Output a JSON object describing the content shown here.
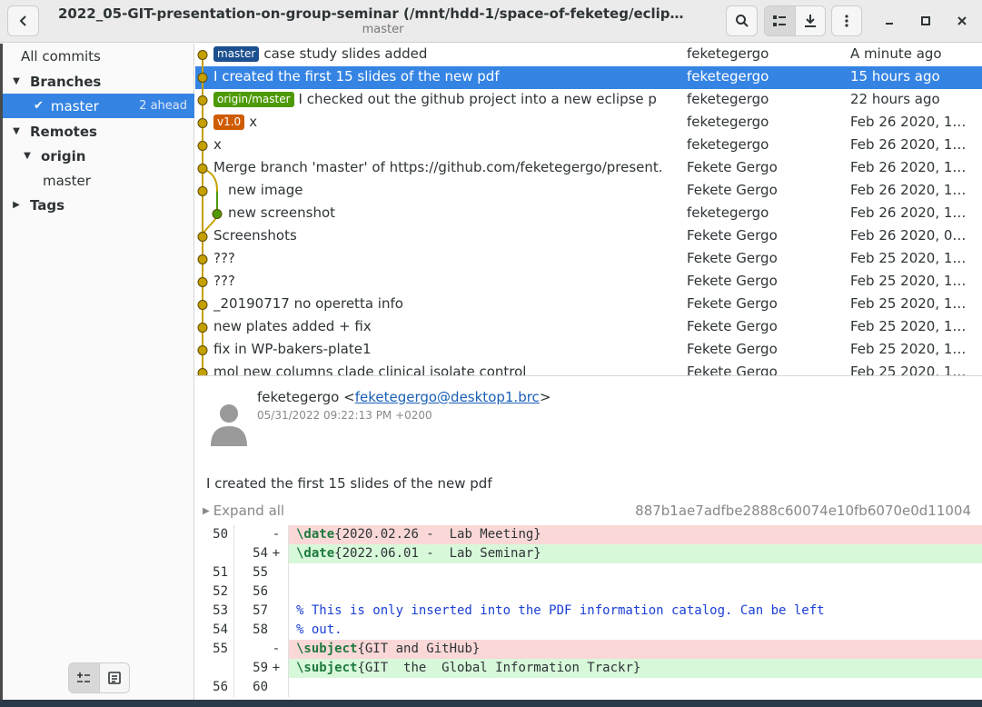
{
  "window": {
    "title": "2022_05-GIT-presentation-on-group-seminar (/mnt/hdd-1/space-of-feketeg/eclip…",
    "subtitle": "master"
  },
  "sidebar": {
    "all_commits": "All commits",
    "branches_label": "Branches",
    "branch_master": "master",
    "branch_master_status": "2 ahead",
    "remotes_label": "Remotes",
    "remote_origin": "origin",
    "remote_origin_master": "master",
    "tags_label": "Tags"
  },
  "commits": [
    {
      "refs": [
        {
          "name": "master",
          "color": "#1c4f8f"
        }
      ],
      "subject": "case study slides added",
      "author": "feketegergo",
      "date": "A minute ago"
    },
    {
      "refs": [],
      "subject": "I created the first 15 slides of the new pdf",
      "author": "feketegergo",
      "date": "15 hours ago"
    },
    {
      "refs": [
        {
          "name": "origin/master",
          "color": "#4e9a06"
        }
      ],
      "subject": "I checked out the github project into a new eclipse p",
      "author": "feketegergo",
      "date": "22 hours ago"
    },
    {
      "refs": [
        {
          "name": "v1.0",
          "color": "#ce5c00"
        }
      ],
      "subject": "x",
      "author": "feketegergo",
      "date": "Feb 26 2020, 1…"
    },
    {
      "refs": [],
      "subject": "x",
      "author": "feketegergo",
      "date": "Feb 26 2020, 1…"
    },
    {
      "refs": [],
      "subject": "Merge branch 'master' of https://github.com/feketegergo/present.",
      "author": "Fekete Gergo",
      "date": "Feb 26 2020, 1…"
    },
    {
      "refs": [],
      "subject": "new image",
      "author": "Fekete Gergo",
      "date": "Feb 26 2020, 1…"
    },
    {
      "refs": [],
      "subject": "new screenshot",
      "author": "feketegergo",
      "date": "Feb 26 2020, 1…"
    },
    {
      "refs": [],
      "subject": "Screenshots",
      "author": "Fekete Gergo",
      "date": "Feb 26 2020, 0…"
    },
    {
      "refs": [],
      "subject": "???",
      "author": "Fekete Gergo",
      "date": "Feb 25 2020, 1…"
    },
    {
      "refs": [],
      "subject": "???",
      "author": "Fekete Gergo",
      "date": "Feb 25 2020, 1…"
    },
    {
      "refs": [],
      "subject": "_20190717 no operetta info",
      "author": "Fekete Gergo",
      "date": "Feb 25 2020, 1…"
    },
    {
      "refs": [],
      "subject": "new plates added + fix",
      "author": "Fekete Gergo",
      "date": "Feb 25 2020, 1…"
    },
    {
      "refs": [],
      "subject": "fix in WP-bakers-plate1",
      "author": "Fekete Gergo",
      "date": "Feb 25 2020, 1…"
    },
    {
      "refs": [],
      "subject": "mol new columns clade clinical isolate control",
      "author": "Fekete Gergo",
      "date": "Feb 25 2020, 1…"
    }
  ],
  "details": {
    "author_name": "feketegergo",
    "author_open": " <",
    "author_email": "feketegergo@desktop1.brc",
    "author_close": ">",
    "date": "05/31/2022 09:22:13 PM +0200",
    "message": "I created the first 15 slides of the new pdf",
    "expand_all": "Expand all",
    "sha": "887b1ae7adfbe2888c60074e10fb6070e0d11004"
  },
  "diff": [
    {
      "type": "del",
      "old": "50",
      "new": "",
      "mark": "-",
      "parts": [
        {
          "t": "\\date",
          "c": "kw"
        },
        {
          "t": "{2020.02.26 -  Lab Meeting}",
          "c": ""
        }
      ]
    },
    {
      "type": "add",
      "old": "",
      "new": "54",
      "mark": "+",
      "parts": [
        {
          "t": "\\date",
          "c": "kw"
        },
        {
          "t": "{2022.06.01 -  Lab Seminar}",
          "c": ""
        }
      ]
    },
    {
      "type": "ctx",
      "old": "51",
      "new": "55",
      "mark": "",
      "parts": []
    },
    {
      "type": "ctx",
      "old": "52",
      "new": "56",
      "mark": "",
      "parts": []
    },
    {
      "type": "ctx",
      "old": "53",
      "new": "57",
      "mark": "",
      "parts": [
        {
          "t": "% This is only inserted into the PDF information catalog. Can be left",
          "c": "comment"
        }
      ]
    },
    {
      "type": "ctx",
      "old": "54",
      "new": "58",
      "mark": "",
      "parts": [
        {
          "t": "% out.",
          "c": "comment"
        }
      ]
    },
    {
      "type": "del",
      "old": "55",
      "new": "",
      "mark": "-",
      "parts": [
        {
          "t": "\\subject",
          "c": "kw"
        },
        {
          "t": "{GIT and GitHub}",
          "c": ""
        }
      ]
    },
    {
      "type": "add",
      "old": "",
      "new": "59",
      "mark": "+",
      "parts": [
        {
          "t": "\\subject",
          "c": "kw"
        },
        {
          "t": "{GIT  the  Global Information Trackr}",
          "c": ""
        }
      ]
    },
    {
      "type": "ctx",
      "old": "56",
      "new": "60",
      "mark": "",
      "parts": []
    }
  ],
  "colors": {
    "accent": "#3584e4",
    "commit_node": "#c4a000",
    "merge_branch": "#4e9a06"
  }
}
